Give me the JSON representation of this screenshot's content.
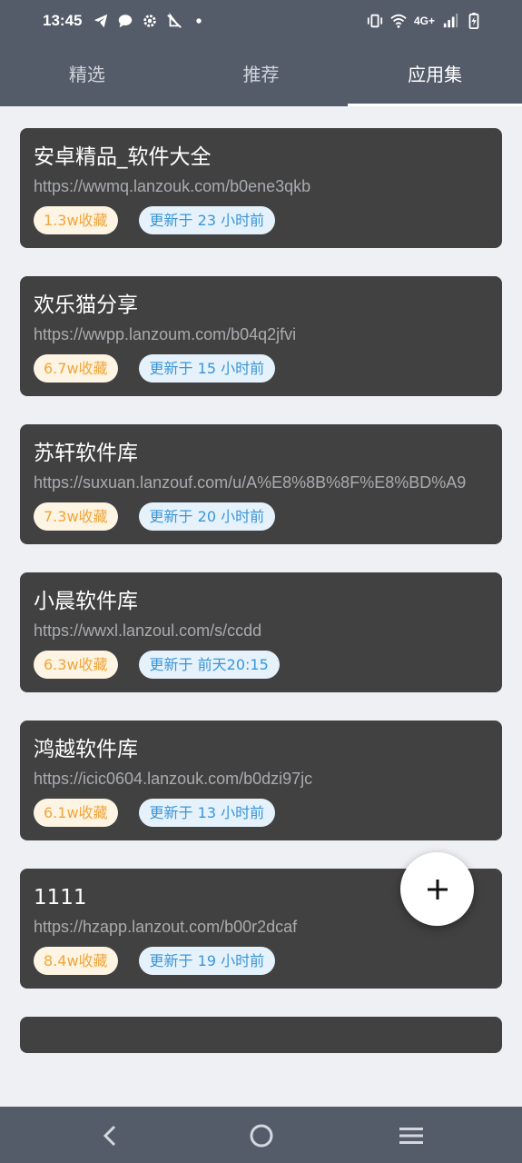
{
  "status_bar": {
    "time": "13:45",
    "network": "4G+",
    "left_icons": [
      "telegram-icon",
      "chat-icon",
      "settings-icon",
      "sail-icon",
      "dot-icon"
    ],
    "right_icons": [
      "vibrate-icon",
      "wifi-icon",
      "signal-icon",
      "battery-charging-icon"
    ]
  },
  "tabs": [
    {
      "label": "精选",
      "active": false
    },
    {
      "label": "推荐",
      "active": false
    },
    {
      "label": "应用集",
      "active": true
    }
  ],
  "cards": [
    {
      "title": "安卓精品_软件大全",
      "url": "https://wwmq.lanzouk.com/b0ene3qkb",
      "favorites": "1.3w收藏",
      "updated": "更新于 23 小时前"
    },
    {
      "title": "欢乐猫分享",
      "url": "https://wwpp.lanzoum.com/b04q2jfvi",
      "favorites": "6.7w收藏",
      "updated": "更新于 15 小时前"
    },
    {
      "title": "苏轩软件库",
      "url": "https://suxuan.lanzouf.com/u/A%E8%8B%8F%E8%BD%A9",
      "favorites": "7.3w收藏",
      "updated": "更新于 20 小时前"
    },
    {
      "title": "小晨软件库",
      "url": "https://wwxl.lanzoul.com/s/ccdd",
      "favorites": "6.3w收藏",
      "updated": "更新于 前天20:15"
    },
    {
      "title": "鸿越软件库",
      "url": "https://icic0604.lanzouk.com/b0dzi97jc",
      "favorites": "6.1w收藏",
      "updated": "更新于 13 小时前"
    },
    {
      "title": "1111",
      "url": "https://hzapp.lanzout.com/b00r2dcaf",
      "favorites": "8.4w收藏",
      "updated": "更新于 19 小时前"
    }
  ],
  "fab": {
    "icon": "plus-icon"
  },
  "nav": {
    "icons": [
      "back-icon",
      "home-icon",
      "menu-icon"
    ]
  },
  "colors": {
    "header": "#545c6a",
    "card": "#414141",
    "fav_bg": "#fdf4e3",
    "fav_text": "#f0a53a",
    "upd_bg": "#e6f2fb",
    "upd_text": "#3a95d6"
  }
}
